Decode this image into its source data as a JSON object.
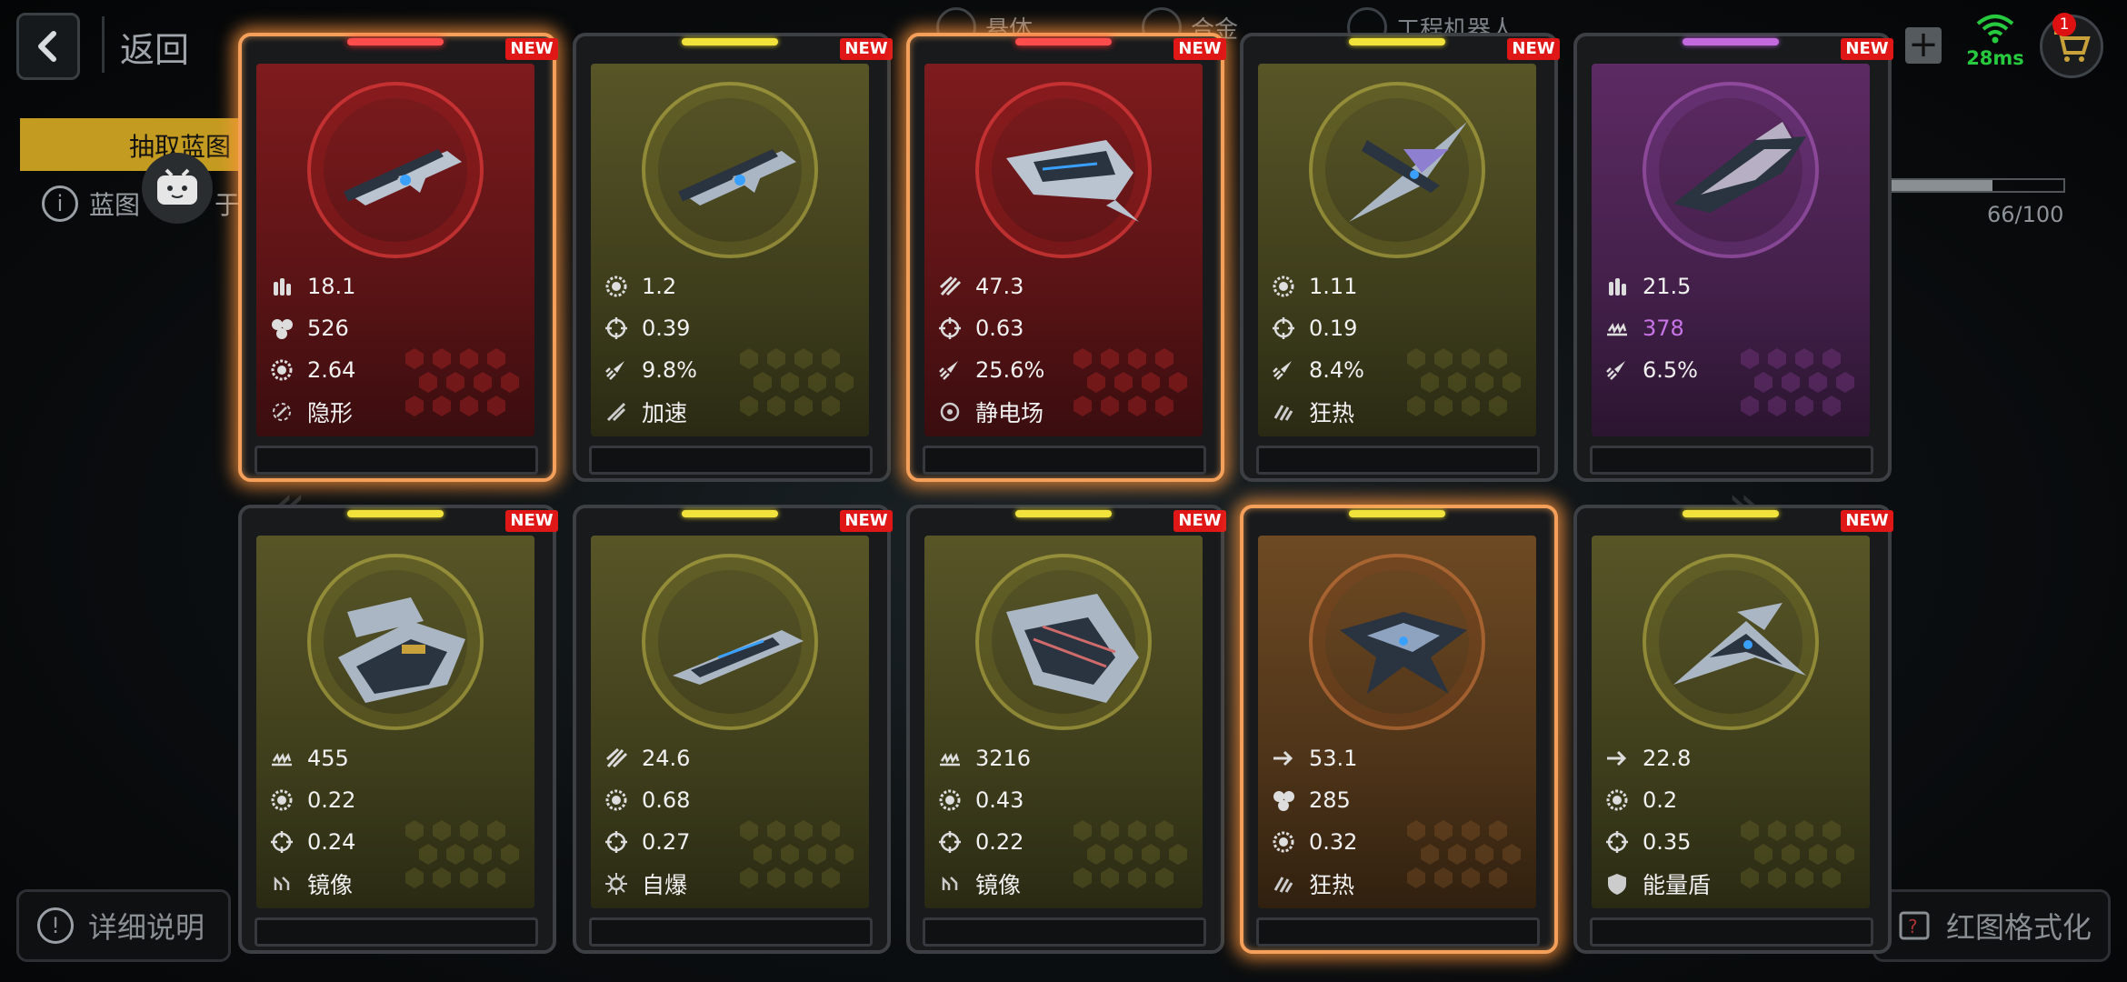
{
  "header": {
    "back_label": "返回",
    "tabs": [
      "悬体",
      "合金",
      "工程机器人"
    ],
    "ping": "28ms",
    "cart_badge": "1"
  },
  "side": {
    "draw_tab": "抽取蓝图",
    "blueprint_info": "蓝图",
    "blueprint_info_tail": "于",
    "progress": "66/100",
    "progress_fraction": 0.66
  },
  "bottom": {
    "detail_label": "详细说明",
    "format_label": "红图格式化"
  },
  "cards": [
    {
      "rarity": "red",
      "new": "NEW",
      "ship": "gunship",
      "stats": [
        {
          "icon": "ammo-icon",
          "value": "18.1"
        },
        {
          "icon": "cluster-icon",
          "value": "526"
        },
        {
          "icon": "gear-icon",
          "value": "2.64"
        }
      ],
      "skill_icon": "stealth-icon",
      "skill": "隐形"
    },
    {
      "rarity": "yellow",
      "new": "NEW",
      "ship": "gunship",
      "stats": [
        {
          "icon": "gear-icon",
          "value": "1.2"
        },
        {
          "icon": "crosshair-icon",
          "value": "0.39"
        },
        {
          "icon": "rocket-icon",
          "value": "9.8%"
        }
      ],
      "skill_icon": "boost-icon",
      "skill": "加速"
    },
    {
      "rarity": "red",
      "new": "NEW",
      "ship": "cruiser",
      "stats": [
        {
          "icon": "missile-icon",
          "value": "47.3"
        },
        {
          "icon": "crosshair-icon",
          "value": "0.63"
        },
        {
          "icon": "rocket-icon",
          "value": "25.6%"
        }
      ],
      "skill_icon": "static-field-icon",
      "skill": "静电场"
    },
    {
      "rarity": "yellow",
      "new": "NEW",
      "ship": "interceptor",
      "stats": [
        {
          "icon": "gear-icon",
          "value": "1.11"
        },
        {
          "icon": "crosshair-icon",
          "value": "0.19"
        },
        {
          "icon": "rocket-icon",
          "value": "8.4%"
        }
      ],
      "skill_icon": "frenzy-icon",
      "skill": "狂热"
    },
    {
      "rarity": "purple",
      "new": "NEW",
      "ship": "bomber",
      "stats": [
        {
          "icon": "ammo-icon",
          "value": "21.5"
        },
        {
          "icon": "armor-icon",
          "value": "378",
          "purple": true
        },
        {
          "icon": "rocket-icon",
          "value": "6.5%"
        }
      ],
      "skill_icon": "",
      "skill": ""
    },
    {
      "rarity": "yellow",
      "new": "NEW",
      "ship": "carrier",
      "stats": [
        {
          "icon": "armor-icon",
          "value": "455"
        },
        {
          "icon": "gear-icon",
          "value": "0.22"
        },
        {
          "icon": "crosshair-icon",
          "value": "0.24"
        }
      ],
      "skill_icon": "mirror-icon",
      "skill": "镜像"
    },
    {
      "rarity": "yellow",
      "new": "NEW",
      "ship": "frigate",
      "stats": [
        {
          "icon": "missile-icon",
          "value": "24.6"
        },
        {
          "icon": "gear-icon",
          "value": "0.68"
        },
        {
          "icon": "crosshair-icon",
          "value": "0.27"
        }
      ],
      "skill_icon": "self-destruct-icon",
      "skill": "自爆"
    },
    {
      "rarity": "yellow",
      "new": "NEW",
      "ship": "battleship",
      "stats": [
        {
          "icon": "armor-icon",
          "value": "3216"
        },
        {
          "icon": "gear-icon",
          "value": "0.43"
        },
        {
          "icon": "crosshair-icon",
          "value": "0.22"
        }
      ],
      "skill_icon": "mirror-icon",
      "skill": "镜像"
    },
    {
      "rarity": "orange",
      "new": "",
      "ship": "interceptor2",
      "stats": [
        {
          "icon": "speed-icon",
          "value": "53.1"
        },
        {
          "icon": "cluster-icon",
          "value": "285"
        },
        {
          "icon": "gear-icon",
          "value": "0.32"
        }
      ],
      "skill_icon": "frenzy-icon",
      "skill": "狂热"
    },
    {
      "rarity": "yellow",
      "new": "NEW",
      "ship": "fighter",
      "stats": [
        {
          "icon": "speed-icon",
          "value": "22.8"
        },
        {
          "icon": "gear-icon",
          "value": "0.2"
        },
        {
          "icon": "crosshair-icon",
          "value": "0.35"
        }
      ],
      "skill_icon": "energy-shield-icon",
      "skill": "能量盾"
    }
  ],
  "colors": {
    "glow": "#f5a05a",
    "new_badge": "#e01717",
    "purple_value": "#c774e6",
    "ping_green": "#27c93f"
  }
}
